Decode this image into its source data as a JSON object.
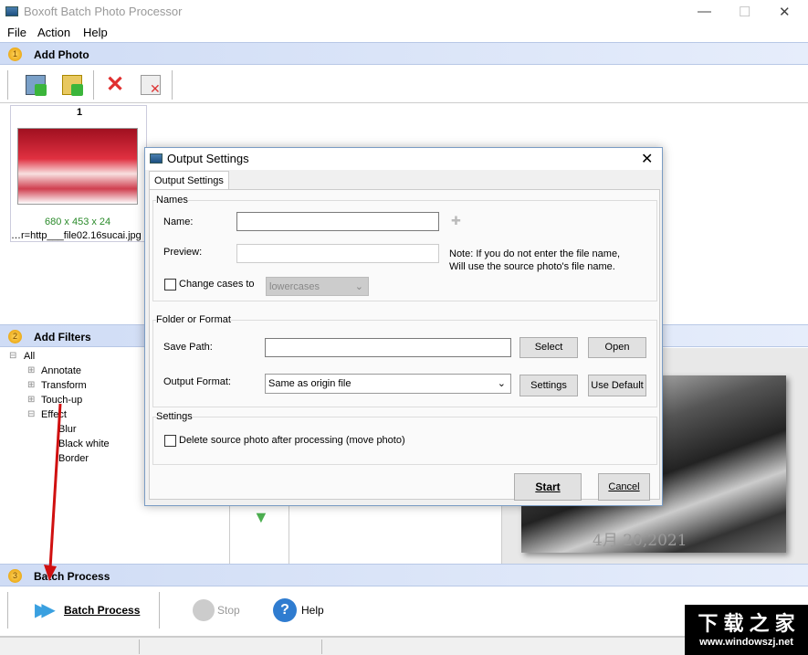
{
  "window": {
    "title": "Boxoft Batch Photo Processor",
    "minimize": "—",
    "maximize": "☐",
    "close": "✕"
  },
  "menu": [
    "File",
    "Action",
    "Help"
  ],
  "sections": [
    {
      "num": "1",
      "label": "Add Photo"
    },
    {
      "num": "2",
      "label": "Add Filters"
    },
    {
      "num": "3",
      "label": "Batch Process"
    }
  ],
  "photo": {
    "index": "1",
    "size": "680 x 453 x 24",
    "filename": "…r=http___file02.16sucai.jpg"
  },
  "tree": {
    "root": "All",
    "items": [
      "Annotate",
      "Transform",
      "Touch-up",
      "Effect"
    ],
    "effect_children": [
      "Blur",
      "Black white",
      "Border"
    ]
  },
  "preview_watermark": "4月 20,2021",
  "dialog": {
    "title": "Output Settings",
    "tab": "Output Settings",
    "names": {
      "group": "Names",
      "name_label": "Name:",
      "name_value": "",
      "preview_label": "Preview:",
      "preview_value": "",
      "note1": "Note: If you do not enter the file name,",
      "note2": "Will use the source photo's file name.",
      "change_cases_label": "Change cases to",
      "change_cases_checked": false,
      "case_option": "lowercases"
    },
    "folder": {
      "group": "Folder or Format",
      "save_path_label": "Save Path:",
      "save_path_value": "",
      "select": "Select",
      "open": "Open",
      "format_label": "Output Format:",
      "format_value": "Same as origin file",
      "settings": "Settings",
      "use_default": "Use Default"
    },
    "settings": {
      "group": "Settings",
      "delete_label": "Delete source photo after processing (move photo)",
      "delete_checked": false
    },
    "start": "Start",
    "cancel": "Cancel"
  },
  "batch_toolbar": {
    "batch": "Batch Process",
    "stop": "Stop",
    "help": "Help"
  },
  "watermark": {
    "line1": "下 载 之 家",
    "line2": "www.windowszj.net"
  }
}
